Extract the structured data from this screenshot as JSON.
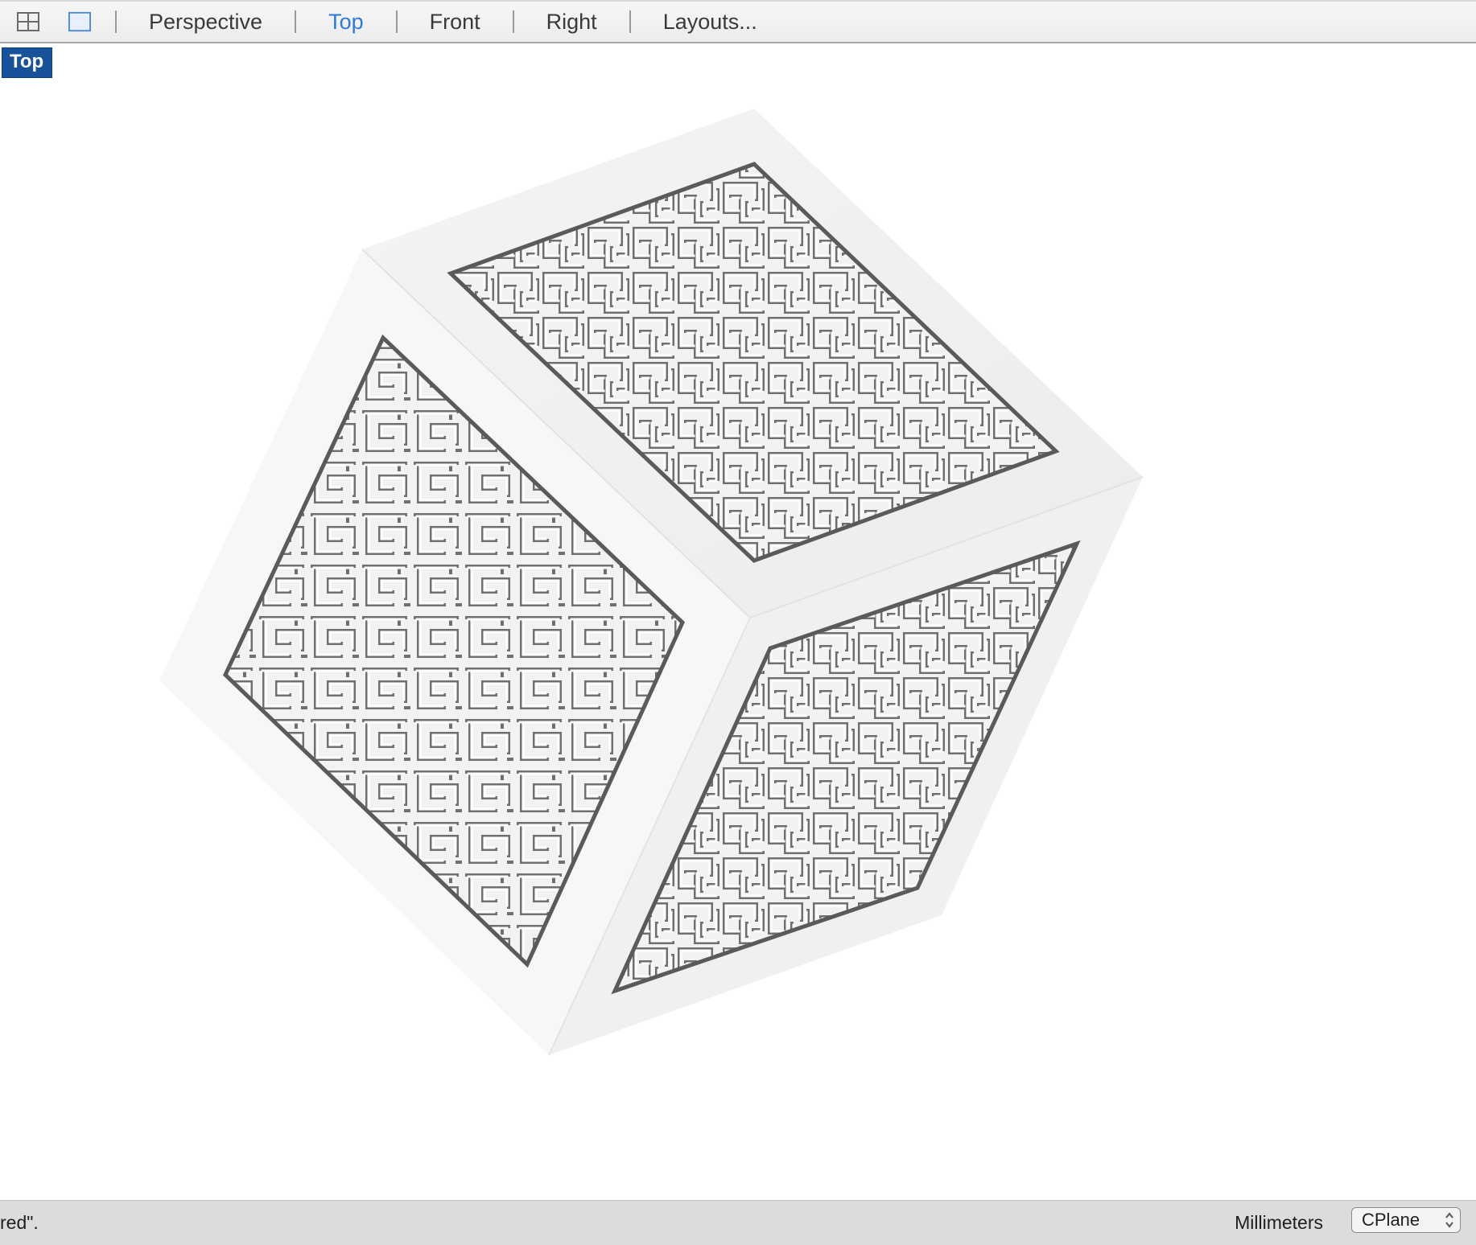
{
  "toolbar": {
    "grid_icon": "four-viewports-icon",
    "single_icon": "single-viewport-icon",
    "tabs": [
      {
        "label": "Perspective"
      },
      {
        "label": "Top"
      },
      {
        "label": "Front"
      },
      {
        "label": "Right"
      },
      {
        "label": "Layouts..."
      }
    ],
    "active_tab": "Top",
    "active_color": "#2f7ad8"
  },
  "viewport": {
    "label": "Top",
    "label_bg": "#17529b",
    "object": "cube-with-maze-faces"
  },
  "status": {
    "message": "red\".",
    "units": "Millimeters",
    "cplane": "CPlane"
  }
}
